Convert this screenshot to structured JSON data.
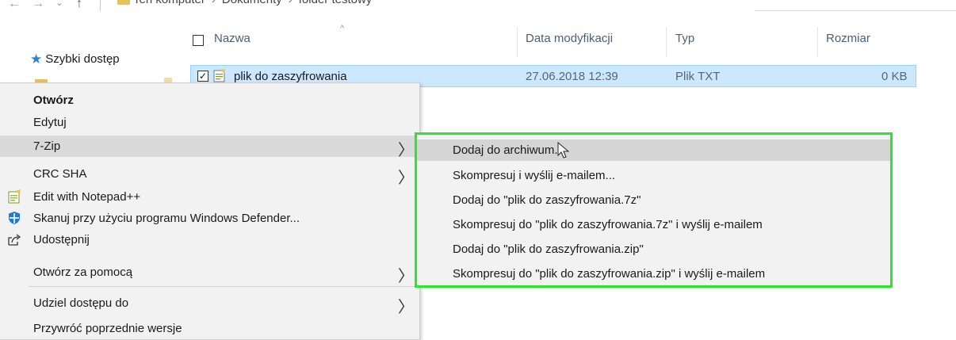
{
  "address_bar": {
    "nav_back": "←",
    "nav_forward": "→",
    "nav_recent": "⌄",
    "nav_up": "↑",
    "path": [
      "Ten komputer",
      "Dokumenty",
      "folder testowy"
    ],
    "separator": "›"
  },
  "nav_pane": {
    "quick_access": "Szybki dostęp"
  },
  "file_list": {
    "columns": {
      "name": "Nazwa",
      "date": "Data modyfikacji",
      "type": "Typ",
      "size": "Rozmiar"
    },
    "sort_indicator": "^",
    "rows": [
      {
        "name": "plik do zaszyfrowania",
        "date": "27.06.2018 12:39",
        "type": "Plik TXT",
        "size": "0 KB",
        "checked": "✓"
      }
    ]
  },
  "context_menu": {
    "items": [
      {
        "label": "Otwórz"
      },
      {
        "label": "Edytuj"
      },
      {
        "label": "7-Zip",
        "submenu_arrow": "〉"
      },
      {
        "label": "CRC SHA",
        "submenu_arrow": "〉"
      },
      {
        "label": "Edit with Notepad++",
        "icon": "notepad-plus-plus-icon"
      },
      {
        "label": "Skanuj przy użyciu programu Windows Defender...",
        "icon": "windows-defender-icon"
      },
      {
        "label": "Udostępnij",
        "icon": "share-icon"
      },
      {
        "label": "Otwórz za pomocą",
        "submenu_arrow": "〉"
      },
      {
        "label": "Udziel dostępu do",
        "submenu_arrow": "〉"
      },
      {
        "label": "Przywróć poprzednie wersje"
      }
    ]
  },
  "submenu_7zip": {
    "highlight_color": "#2ce52c",
    "items": [
      {
        "label": "Dodaj do archiwum..."
      },
      {
        "label": "Skompresuj i wyślij e-mailem..."
      },
      {
        "label": "Dodaj do \"plik do zaszyfrowania.7z\""
      },
      {
        "label": "Skompresuj do \"plik do zaszyfrowania.7z\" i wyślij e-mailem"
      },
      {
        "label": "Dodaj do \"plik do zaszyfrowania.zip\""
      },
      {
        "label": "Skompresuj do \"plik do zaszyfrowania.zip\" i wyślij e-mailem"
      }
    ]
  }
}
